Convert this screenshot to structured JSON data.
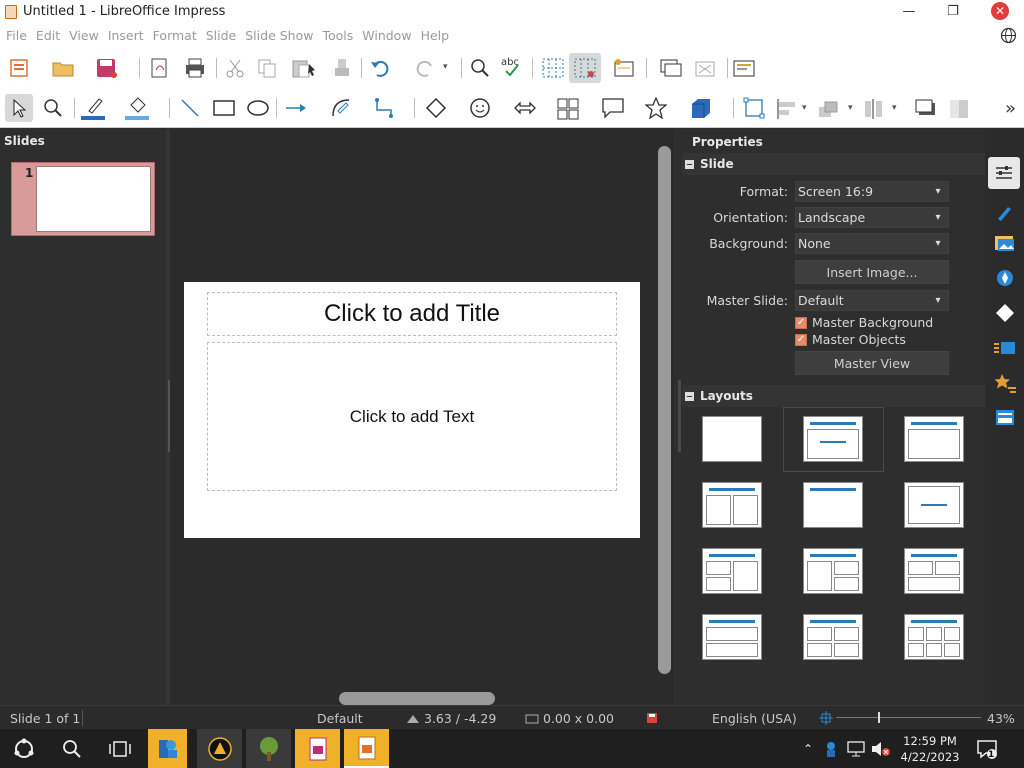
{
  "window": {
    "title": "Untitled 1 - LibreOffice Impress",
    "minimize": "—",
    "restore": "❐",
    "close": "✕"
  },
  "menu": [
    "File",
    "Edit",
    "View",
    "Insert",
    "Format",
    "Slide",
    "Slide Show",
    "Tools",
    "Window",
    "Help"
  ],
  "slides_pane": {
    "title": "Slides",
    "thumb_number": "1"
  },
  "slide": {
    "title_placeholder": "Click to add Title",
    "text_placeholder": "Click to add Text"
  },
  "sidebar": {
    "title": "Properties",
    "slide_section": {
      "heading": "Slide",
      "format_label": "Format:",
      "format_value": "Screen 16:9",
      "orientation_label": "Orientation:",
      "orientation_value": "Landscape",
      "background_label": "Background:",
      "background_value": "None",
      "insert_image_button": "Insert Image...",
      "master_slide_label": "Master Slide:",
      "master_slide_value": "Default",
      "master_background": "Master Background",
      "master_objects": "Master Objects",
      "master_view_button": "Master View"
    },
    "layouts_section": {
      "heading": "Layouts"
    }
  },
  "status": {
    "slide_position": "Slide 1 of 1",
    "master": "Default",
    "position": "3.63 / -4.29",
    "size": "0.00 x 0.00",
    "language": "English (USA)",
    "zoom": "43%"
  },
  "taskbar": {
    "time": "12:59 PM",
    "date": "4/22/2023",
    "notification_count": "1"
  },
  "colors": {
    "accent": "#2a7bb8",
    "selected_thumb": "#d99a9a",
    "checkbox": "#e8896a"
  }
}
